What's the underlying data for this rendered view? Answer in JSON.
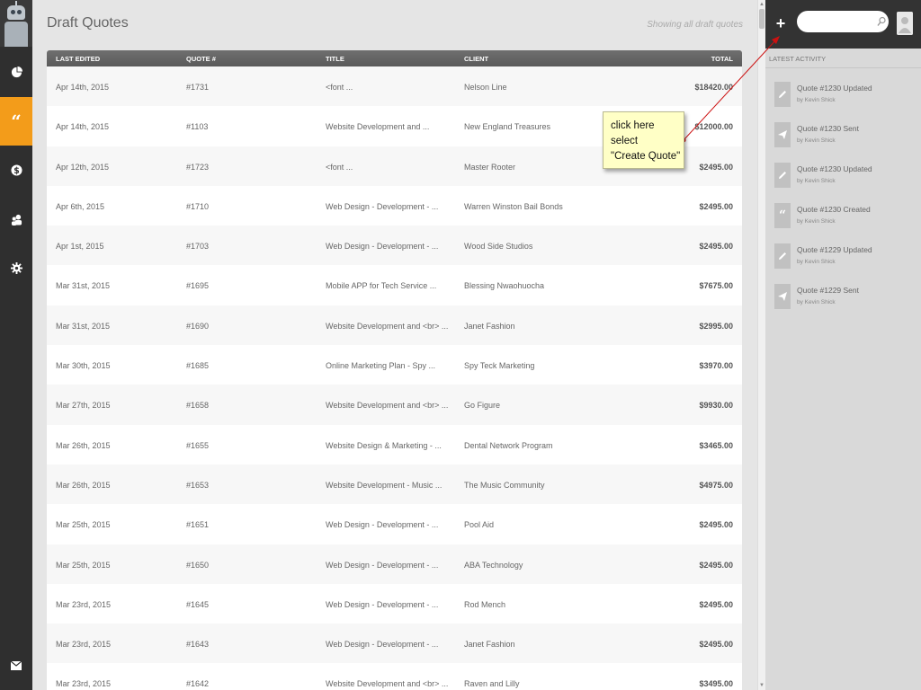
{
  "nav": {
    "items": [
      {
        "name": "dashboard",
        "icon": "pie-chart-icon"
      },
      {
        "name": "quotes",
        "icon": "quote-icon",
        "active": true
      },
      {
        "name": "payments",
        "icon": "dollar-icon"
      },
      {
        "name": "clients",
        "icon": "users-icon"
      },
      {
        "name": "settings",
        "icon": "gear-icon"
      },
      {
        "name": "messages",
        "icon": "mail-icon"
      }
    ],
    "accent_color": "#f39c1a"
  },
  "header": {
    "title": "Draft Quotes",
    "showing": "Showing all draft quotes"
  },
  "table": {
    "columns": [
      "LAST EDITED",
      "QUOTE #",
      "TITLE",
      "CLIENT",
      "TOTAL"
    ],
    "rows": [
      [
        "Apr 14th, 2015",
        "#1731",
        "<font ...",
        "Nelson Line",
        "$18420.00"
      ],
      [
        "Apr 14th, 2015",
        "#1103",
        "Website Development and ...",
        "New England Treasures",
        "$12000.00"
      ],
      [
        "Apr 12th, 2015",
        "#1723",
        "<font ...",
        "Master Rooter",
        "$2495.00"
      ],
      [
        "Apr 6th, 2015",
        "#1710",
        "Web Design - Development - ...",
        "Warren Winston Bail Bonds",
        "$2495.00"
      ],
      [
        "Apr 1st, 2015",
        "#1703",
        "Web Design - Development - ...",
        "Wood Side Studios",
        "$2495.00"
      ],
      [
        "Mar 31st, 2015",
        "#1695",
        "Mobile APP for Tech Service ...",
        "Blessing Nwaohuocha",
        "$7675.00"
      ],
      [
        "Mar 31st, 2015",
        "#1690",
        "Website Development and <br> ...",
        "Janet Fashion",
        "$2995.00"
      ],
      [
        "Mar 30th, 2015",
        "#1685",
        "Online Marketing Plan - Spy ...",
        "Spy Teck Marketing",
        "$3970.00"
      ],
      [
        "Mar 27th, 2015",
        "#1658",
        "Website Development and <br> ...",
        "Go Figure",
        "$9930.00"
      ],
      [
        "Mar 26th, 2015",
        "#1655",
        "Website Design & Marketing - ...",
        "Dental Network Program",
        "$3465.00"
      ],
      [
        "Mar 26th, 2015",
        "#1653",
        "Website Development - Music ...",
        "The Music Community",
        "$4975.00"
      ],
      [
        "Mar 25th, 2015",
        "#1651",
        "Web Design - Development - ...",
        "Pool Aid",
        "$2495.00"
      ],
      [
        "Mar 25th, 2015",
        "#1650",
        "Web Design - Development - ...",
        "ABA Technology",
        "$2495.00"
      ],
      [
        "Mar 23rd, 2015",
        "#1645",
        "Web Design - Development - ...",
        "Rod Mench",
        "$2495.00"
      ],
      [
        "Mar 23rd, 2015",
        "#1643",
        "Web Design - Development - ...",
        "Janet Fashion",
        "$2495.00"
      ],
      [
        "Mar 23rd, 2015",
        "#1642",
        "Website Development and <br> ...",
        "Raven and Lilly",
        "$3495.00"
      ]
    ]
  },
  "topbar": {
    "plus_label": "+",
    "search_placeholder": ""
  },
  "activity": {
    "header": "LATEST ACTIVITY",
    "items": [
      {
        "title": "Quote #1230 Updated",
        "by": "by Kevin Shick",
        "icon": "pencil-icon"
      },
      {
        "title": "Quote #1230 Sent",
        "by": "by Kevin Shick",
        "icon": "send-icon"
      },
      {
        "title": "Quote #1230 Updated",
        "by": "by Kevin Shick",
        "icon": "pencil-icon"
      },
      {
        "title": "Quote #1230 Created",
        "by": "by Kevin Shick",
        "icon": "quote-icon"
      },
      {
        "title": "Quote #1229 Updated",
        "by": "by Kevin Shick",
        "icon": "pencil-icon"
      },
      {
        "title": "Quote #1229 Sent",
        "by": "by Kevin Shick",
        "icon": "send-icon"
      }
    ]
  },
  "callout": {
    "line1": "click here",
    "line2": "select",
    "line3": "\"Create Quote\""
  }
}
